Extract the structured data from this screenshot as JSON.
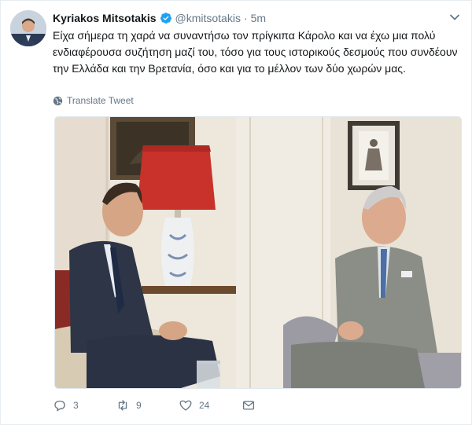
{
  "tweet": {
    "author_name": "Kyriakos Mitsotakis",
    "handle": "@kmitsotakis",
    "separator": "·",
    "time": "5m",
    "text": "Είχα σήμερα τη χαρά να συναντήσω τον πρίγκιπα Κάρολο και να έχω μια πολύ ενδιαφέρουσα συζήτηση μαζί του, τόσο για τους ιστορικούς δεσμούς που συνδέουν την Ελλάδα και την Βρετανία, όσο και για το μέλλον των δύο χωρών μας.",
    "translate_label": "Translate Tweet",
    "verified_color": "#1da1f2"
  },
  "actions": {
    "reply_count": "3",
    "retweet_count": "9",
    "like_count": "24"
  }
}
